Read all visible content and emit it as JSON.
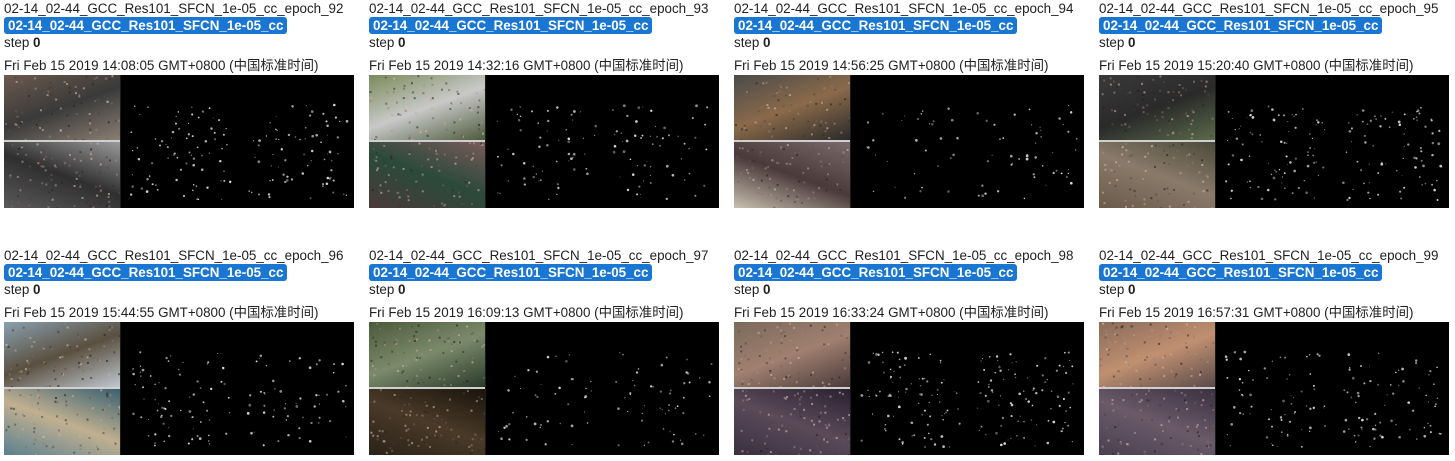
{
  "cards": [
    {
      "title": "02-14_02-44_GCC_Res101_SFCN_1e-05_cc_epoch_92",
      "tag": "02-14_02-44_GCC_Res101_SFCN_1e-05_cc",
      "step_label": "step",
      "step_value": "0",
      "time": "Fri Feb 15 2019 14:08:05 GMT+0800 (中国标准时间)",
      "image": {
        "top_colors": [
          "#6b5a4e",
          "#3a3a3a",
          "#8a7f72"
        ],
        "bottom_colors": [
          "#5a5a5a",
          "#2f2f2f",
          "#9a9a9a"
        ]
      }
    },
    {
      "title": "02-14_02-44_GCC_Res101_SFCN_1e-05_cc_epoch_93",
      "tag": "02-14_02-44_GCC_Res101_SFCN_1e-05_cc",
      "step_label": "step",
      "step_value": "0",
      "time": "Fri Feb 15 2019 14:32:16 GMT+0800 (中国标准时间)",
      "image": {
        "top_colors": [
          "#7a8a5a",
          "#c9c9c9",
          "#4a5a3a"
        ],
        "bottom_colors": [
          "#4a3a3a",
          "#2a4a3a",
          "#7a5a5a"
        ]
      }
    },
    {
      "title": "02-14_02-44_GCC_Res101_SFCN_1e-05_cc_epoch_94",
      "tag": "02-14_02-44_GCC_Res101_SFCN_1e-05_cc",
      "step_label": "step",
      "step_value": "0",
      "time": "Fri Feb 15 2019 14:56:25 GMT+0800 (中国标准时间)",
      "image": {
        "top_colors": [
          "#4a4a4a",
          "#8a6a4a",
          "#2a2a2a"
        ],
        "bottom_colors": [
          "#c9c0b0",
          "#4a3a3a",
          "#7a6a6a"
        ]
      }
    },
    {
      "title": "02-14_02-44_GCC_Res101_SFCN_1e-05_cc_epoch_95",
      "tag": "02-14_02-44_GCC_Res101_SFCN_1e-05_cc",
      "step_label": "step",
      "step_value": "0",
      "time": "Fri Feb 15 2019 15:20:40 GMT+0800 (中国标准时间)",
      "image": {
        "top_colors": [
          "#3a3a3a",
          "#2a2a2a",
          "#5a6a4a"
        ],
        "bottom_colors": [
          "#6a5a4a",
          "#8a7a6a",
          "#4a4a3a"
        ]
      }
    },
    {
      "title": "02-14_02-44_GCC_Res101_SFCN_1e-05_cc_epoch_96",
      "tag": "02-14_02-44_GCC_Res101_SFCN_1e-05_cc",
      "step_label": "step",
      "step_value": "0",
      "time": "Fri Feb 15 2019 15:44:55 GMT+0800 (中国标准时间)",
      "image": {
        "top_colors": [
          "#8aa0b0",
          "#5a5040",
          "#c0c8d0"
        ],
        "bottom_colors": [
          "#5a8090",
          "#c0b090",
          "#3a6070"
        ]
      }
    },
    {
      "title": "02-14_02-44_GCC_Res101_SFCN_1e-05_cc_epoch_97",
      "tag": "02-14_02-44_GCC_Res101_SFCN_1e-05_cc",
      "step_label": "step",
      "step_value": "0",
      "time": "Fri Feb 15 2019 16:09:13 GMT+0800 (中国标准时间)",
      "image": {
        "top_colors": [
          "#4a5a3a",
          "#7a8a6a",
          "#2a3a2a"
        ],
        "bottom_colors": [
          "#2a2218",
          "#4a3a28",
          "#1a140c"
        ]
      }
    },
    {
      "title": "02-14_02-44_GCC_Res101_SFCN_1e-05_cc_epoch_98",
      "tag": "02-14_02-44_GCC_Res101_SFCN_1e-05_cc",
      "step_label": "step",
      "step_value": "0",
      "time": "Fri Feb 15 2019 16:33:24 GMT+0800 (中国标准时间)",
      "image": {
        "top_colors": [
          "#7a6a5a",
          "#a08070",
          "#4a3a3a"
        ],
        "bottom_colors": [
          "#3a3040",
          "#5a4a5a",
          "#2a2030"
        ]
      }
    },
    {
      "title": "02-14_02-44_GCC_Res101_SFCN_1e-05_cc_epoch_99",
      "tag": "02-14_02-44_GCC_Res101_SFCN_1e-05_cc",
      "step_label": "step",
      "step_value": "0",
      "time": "Fri Feb 15 2019 16:57:31 GMT+0800 (中国标准时间)",
      "image": {
        "top_colors": [
          "#8a6a5a",
          "#c09070",
          "#5a4a4a"
        ],
        "bottom_colors": [
          "#4a4050",
          "#6a5a6a",
          "#3a3040"
        ]
      }
    }
  ],
  "colors": {
    "tag_background": "#1976d2",
    "tag_text": "#ffffff",
    "text": "#212121",
    "density_background": "#000000",
    "density_dots": "#e8e8e8"
  }
}
